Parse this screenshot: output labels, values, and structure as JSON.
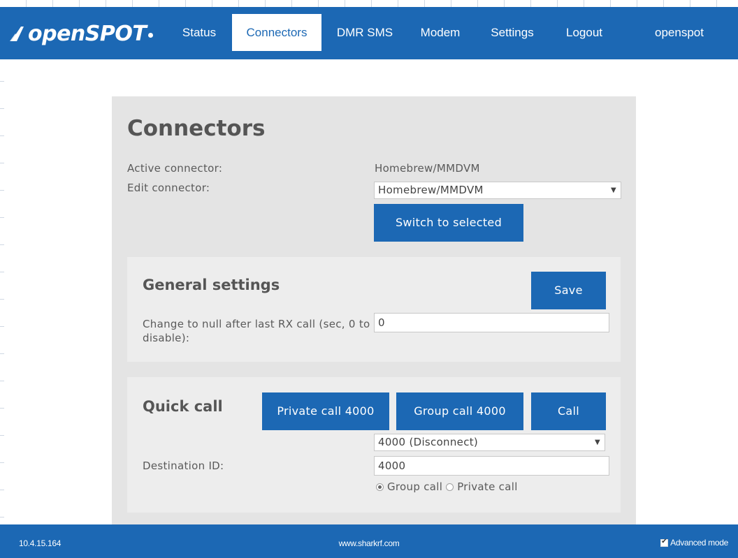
{
  "brand": {
    "name": "openSPOT"
  },
  "nav": {
    "items": [
      {
        "label": "Status"
      },
      {
        "label": "Connectors"
      },
      {
        "label": "DMR SMS"
      },
      {
        "label": "Modem"
      },
      {
        "label": "Settings"
      },
      {
        "label": "Logout"
      },
      {
        "label": "openspot"
      }
    ],
    "active": "Connectors"
  },
  "page": {
    "title": "Connectors",
    "active_connector_label": "Active connector:",
    "active_connector_value": "Homebrew/MMDVM",
    "edit_connector_label": "Edit connector:",
    "edit_connector_value": "Homebrew/MMDVM",
    "switch_button": "Switch to selected"
  },
  "general": {
    "title": "General settings",
    "save_button": "Save",
    "null_label": "Change to null after last RX call (sec, 0 to disable):",
    "null_value": "0"
  },
  "quick_call": {
    "title": "Quick call",
    "private_call_button": "Private call 4000",
    "group_call_button": "Group call 4000",
    "call_button": "Call",
    "preset_value": "4000 (Disconnect)",
    "destination_label": "Destination ID:",
    "destination_value": "4000",
    "radio_group": "Group call",
    "radio_private": "Private call",
    "selected": "Group call"
  },
  "footer": {
    "ip": "10.4.15.164",
    "site": "www.sharkrf.com",
    "advanced_mode": "Advanced mode",
    "advanced_checked": true
  },
  "colors": {
    "primary": "#1c68b4",
    "panel": "#e4e4e4",
    "subpanel": "#ededed"
  }
}
